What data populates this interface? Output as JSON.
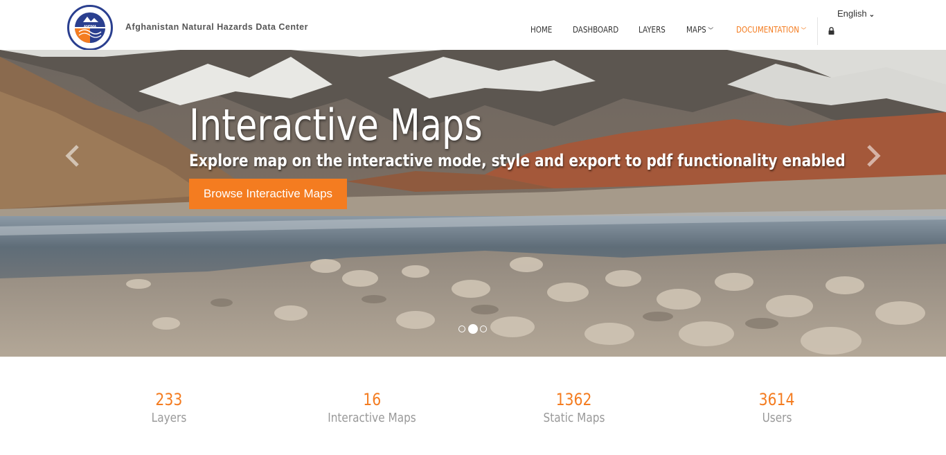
{
  "header": {
    "site_name": "Afghanistan Natural Hazards Data Center",
    "logo_text": "ANDMA",
    "language": "English",
    "nav": [
      {
        "label": "HOME",
        "active": false,
        "dropdown": false
      },
      {
        "label": "DASHBOARD",
        "active": false,
        "dropdown": false
      },
      {
        "label": "LAYERS",
        "active": false,
        "dropdown": false
      },
      {
        "label": "MAPS",
        "active": false,
        "dropdown": true
      },
      {
        "label": "DOCUMENTATION",
        "active": true,
        "dropdown": true
      }
    ],
    "lock_icon": "lock-icon"
  },
  "hero": {
    "title": "Interactive Maps",
    "subtitle": "Explore map on the interactive mode, style and export to pdf functionality enabled",
    "button_label": "Browse Interactive Maps",
    "slides_total": 3,
    "active_slide": 2,
    "prev_icon": "chevron-left-icon",
    "next_icon": "chevron-right-icon"
  },
  "stats": [
    {
      "value": "233",
      "label": "Layers"
    },
    {
      "value": "16",
      "label": "Interactive Maps"
    },
    {
      "value": "1362",
      "label": "Static Maps"
    },
    {
      "value": "3614",
      "label": "Users"
    }
  ],
  "colors": {
    "accent": "#f47c20",
    "text": "#333333",
    "muted": "#999999",
    "logo_blue": "#2a3f8f"
  }
}
